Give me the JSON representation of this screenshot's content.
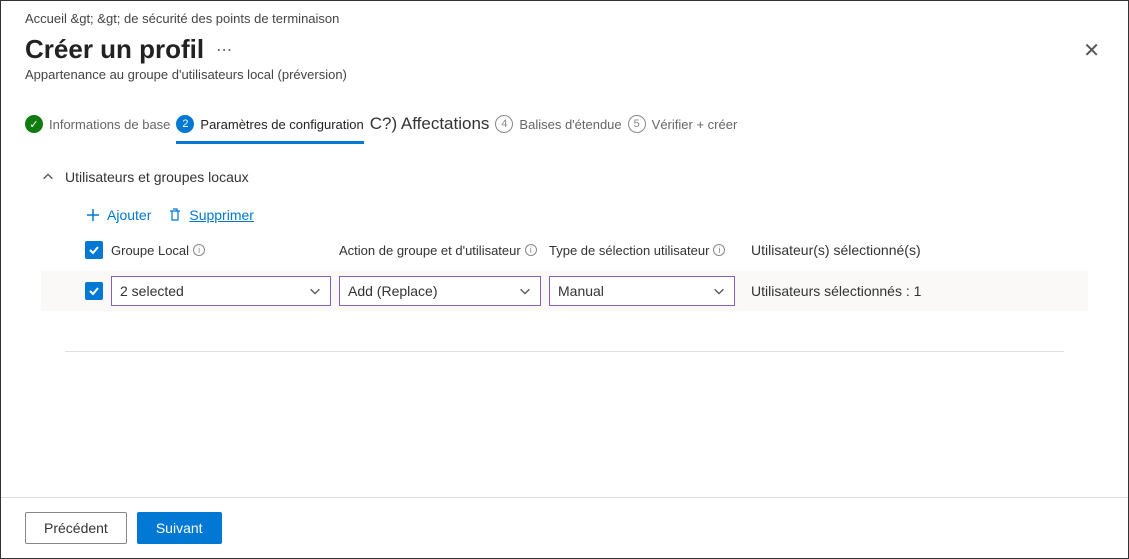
{
  "breadcrumb": {
    "home": "Accueil",
    "sep": "&gt;",
    "tail": "&gt; de sécurité des points de terminaison"
  },
  "header": {
    "title": "Créer un profil",
    "subtitle": "Appartenance au groupe d'utilisateurs local (préversion)"
  },
  "steps": {
    "s1": "Informations de base",
    "s2": "Paramètres de configuration",
    "s3": "C?) Affectations",
    "s4": "Balises d'étendue",
    "s5": "Vérifier + créer"
  },
  "section": {
    "title": "Utilisateurs et groupes locaux"
  },
  "toolbar": {
    "add": "Ajouter",
    "delete": "Supprimer"
  },
  "table": {
    "headers": {
      "local_group": "Groupe Local",
      "group_action": "Action de groupe et d'utilisateur",
      "selection_type": "Type de sélection utilisateur",
      "selected_users": "Utilisateur(s) sélectionné(s)"
    },
    "row": {
      "local_group_value": "2 selected",
      "group_action_value": "Add (Replace)",
      "selection_type_value": "Manual",
      "selected_users_value": "Utilisateurs sélectionnés : 1"
    }
  },
  "footer": {
    "back": "Précédent",
    "next": "Suivant"
  }
}
